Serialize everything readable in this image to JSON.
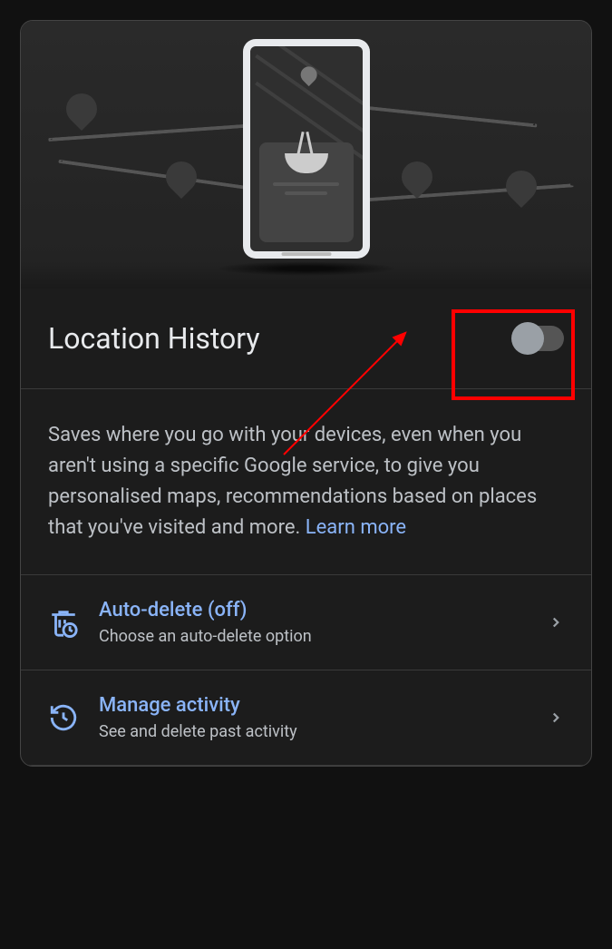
{
  "header": {
    "title": "Location History"
  },
  "description": {
    "text": "Saves where you go with your devices, even when you aren't using a specific Google service, to give you personalised maps, recommendations based on places that you've visited and more. ",
    "learn_more": "Learn more"
  },
  "options": [
    {
      "title": "Auto-delete (off)",
      "subtitle": "Choose an auto-delete option"
    },
    {
      "title": "Manage activity",
      "subtitle": "See and delete past activity"
    }
  ]
}
